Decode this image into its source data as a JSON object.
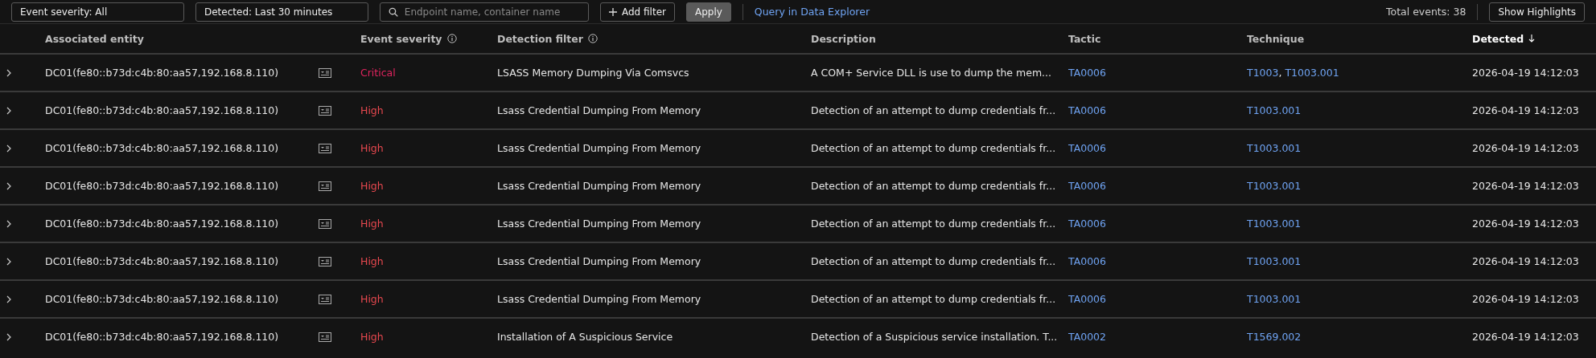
{
  "filter_bar": {
    "filters": [
      {
        "kind": "dropdown",
        "value": "Event severity: All"
      },
      {
        "kind": "dropdown",
        "value": "Detected: Last 30 minutes"
      },
      {
        "kind": "search",
        "placeholder": "Endpoint name, container name"
      }
    ],
    "add_filter": "Add filter",
    "apply": "Apply",
    "query_link": "Query in Data Explorer",
    "total": "Total events: 38",
    "highlights": "Show Highlights"
  },
  "table": {
    "columns": [
      {
        "label": "Associated entity",
        "info": false,
        "sorted": false
      },
      {
        "label": "Event severity",
        "info": true,
        "sorted": false
      },
      {
        "label": "Detection filter",
        "info": true,
        "sorted": false
      },
      {
        "label": "Description",
        "info": false,
        "sorted": false
      },
      {
        "label": "Tactic",
        "info": false,
        "sorted": false
      },
      {
        "label": "Technique",
        "info": false,
        "sorted": false
      },
      {
        "label": "Detected",
        "info": false,
        "sorted": true
      }
    ],
    "rows": [
      {
        "entity": "DC01(fe80::b73d:c4b:80:aa57,192.168.8.110)",
        "severity": "Critical",
        "color": "#e0245e",
        "filter": "LSASS Memory Dumping Via Comsvcs",
        "description": "A COM+ Service DLL is use to dump the mem...",
        "tactic": "TA0006",
        "techniques": [
          {
            "code": "T1003",
            "separator": ","
          },
          {
            "code": "T1003.001"
          }
        ],
        "detected": "2026-04-19 14:12:03"
      },
      {
        "entity": "DC01(fe80::b73d:c4b:80:aa57,192.168.8.110)",
        "severity": "High",
        "color": "#e8484f",
        "filter": "Lsass Credential Dumping From Memory",
        "description": "Detection of an attempt to dump credentials fr...",
        "tactic": "TA0006",
        "techniques": [
          {
            "code": "T1003.001"
          }
        ],
        "detected": "2026-04-19 14:12:03"
      },
      {
        "entity": "DC01(fe80::b73d:c4b:80:aa57,192.168.8.110)",
        "severity": "High",
        "color": "#e8484f",
        "filter": "Lsass Credential Dumping From Memory",
        "description": "Detection of an attempt to dump credentials fr...",
        "tactic": "TA0006",
        "techniques": [
          {
            "code": "T1003.001"
          }
        ],
        "detected": "2026-04-19 14:12:03"
      },
      {
        "entity": "DC01(fe80::b73d:c4b:80:aa57,192.168.8.110)",
        "severity": "High",
        "color": "#e8484f",
        "filter": "Lsass Credential Dumping From Memory",
        "description": "Detection of an attempt to dump credentials fr...",
        "tactic": "TA0006",
        "techniques": [
          {
            "code": "T1003.001"
          }
        ],
        "detected": "2026-04-19 14:12:03"
      },
      {
        "entity": "DC01(fe80::b73d:c4b:80:aa57,192.168.8.110)",
        "severity": "High",
        "color": "#e8484f",
        "filter": "Lsass Credential Dumping From Memory",
        "description": "Detection of an attempt to dump credentials fr...",
        "tactic": "TA0006",
        "techniques": [
          {
            "code": "T1003.001"
          }
        ],
        "detected": "2026-04-19 14:12:03"
      },
      {
        "entity": "DC01(fe80::b73d:c4b:80:aa57,192.168.8.110)",
        "severity": "High",
        "color": "#e8484f",
        "filter": "Lsass Credential Dumping From Memory",
        "description": "Detection of an attempt to dump credentials fr...",
        "tactic": "TA0006",
        "techniques": [
          {
            "code": "T1003.001"
          }
        ],
        "detected": "2026-04-19 14:12:03"
      },
      {
        "entity": "DC01(fe80::b73d:c4b:80:aa57,192.168.8.110)",
        "severity": "High",
        "color": "#e8484f",
        "filter": "Lsass Credential Dumping From Memory",
        "description": "Detection of an attempt to dump credentials fr...",
        "tactic": "TA0006",
        "techniques": [
          {
            "code": "T1003.001"
          }
        ],
        "detected": "2026-04-19 14:12:03"
      },
      {
        "entity": "DC01(fe80::b73d:c4b:80:aa57,192.168.8.110)",
        "severity": "High",
        "color": "#e8484f",
        "filter": "Installation of A Suspicious Service",
        "description": "Detection of a Suspicious service installation. T...",
        "tactic": "TA0002",
        "techniques": [
          {
            "code": "T1569.002"
          }
        ],
        "detected": "2026-04-19 14:12:03"
      }
    ]
  }
}
